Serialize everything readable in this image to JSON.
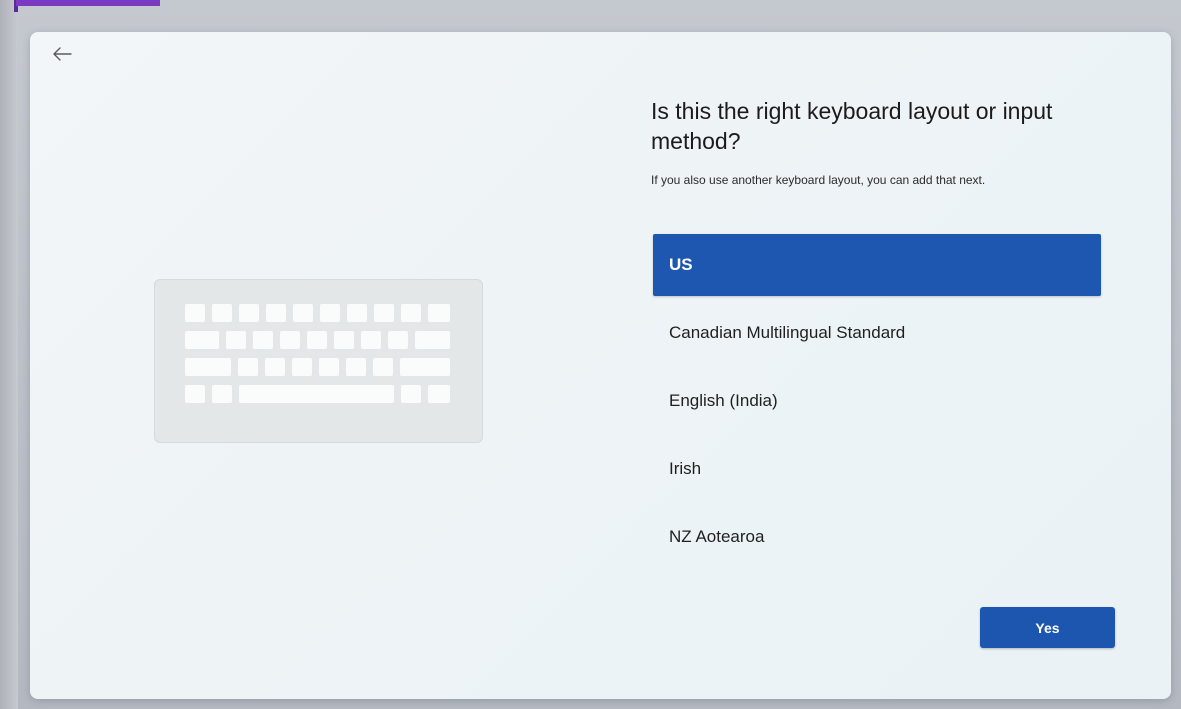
{
  "page": {
    "title": "Is this the right keyboard layout or input method?",
    "subtitle": "If you also use another keyboard layout, you can add that next."
  },
  "navigation": {
    "back_icon": "arrow-left-icon"
  },
  "illustration": {
    "icon": "keyboard-icon"
  },
  "layouts": {
    "selected": "US",
    "items": [
      {
        "label": "US"
      },
      {
        "label": "Canadian Multilingual Standard"
      },
      {
        "label": "English (India)"
      },
      {
        "label": "Irish"
      },
      {
        "label": "NZ Aotearoa"
      }
    ]
  },
  "actions": {
    "yes_label": "Yes"
  },
  "colors": {
    "accent": "#1e57b0",
    "window_background": "#eef3f6",
    "title_text": "#1b1b1b"
  }
}
